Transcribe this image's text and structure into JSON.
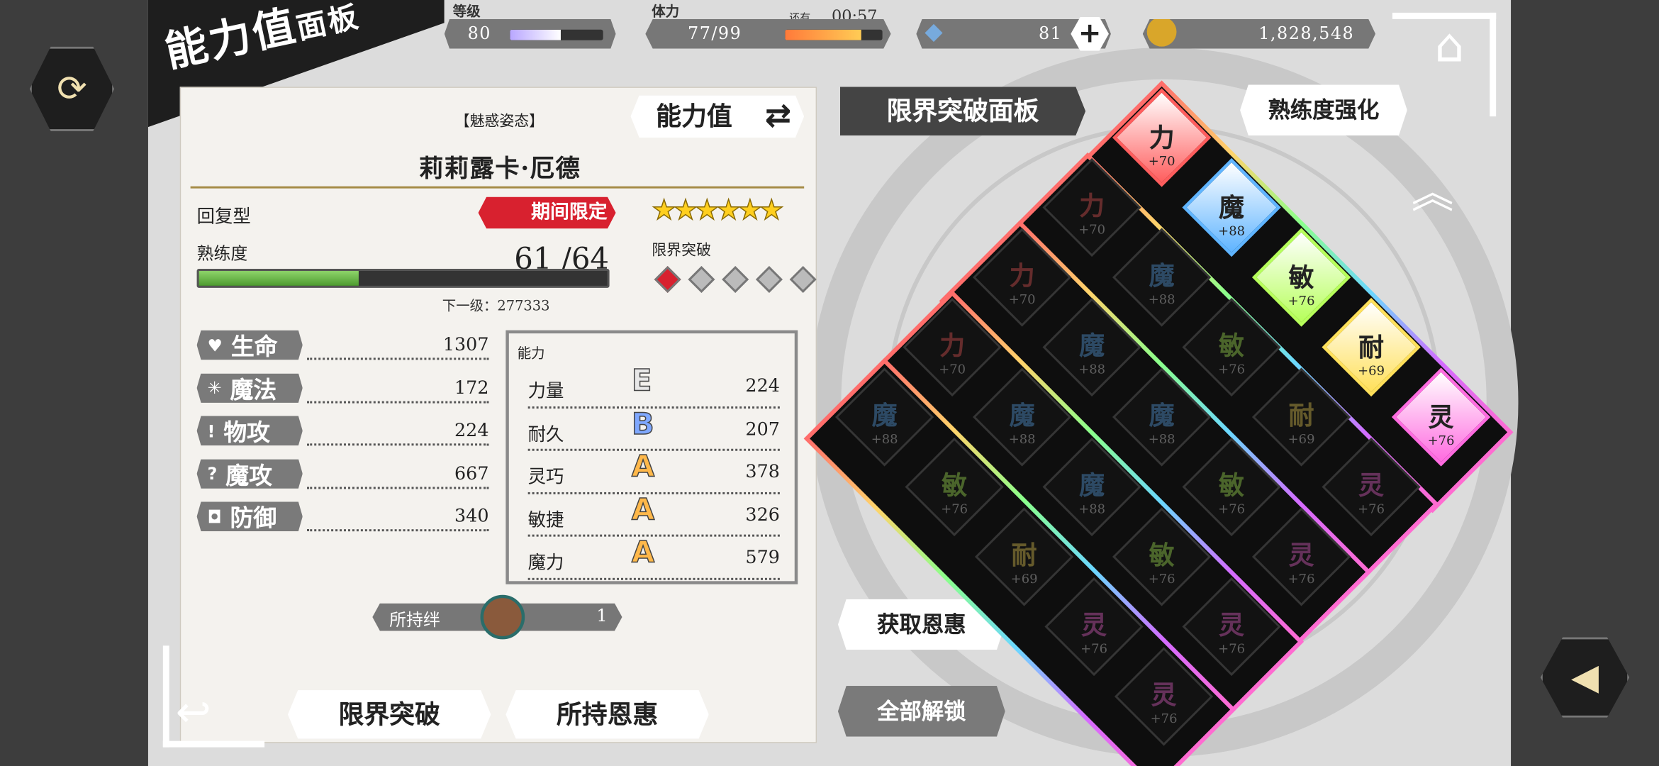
{
  "header": {
    "title_main": "能力值",
    "title_sub": "面板",
    "level_label": "等级",
    "level_value": "80",
    "level_fill": 0.55,
    "stamina_label": "体力",
    "stamina_value": "77/99",
    "recover_label": "还有",
    "recover_time": "00:57",
    "stamina_fill": 0.78,
    "gems": "81",
    "gold": "1,828,548"
  },
  "panel": {
    "costume": "【魅惑姿态】",
    "toggle_label": "能力值",
    "char_name": "莉莉露卡·厄德",
    "type": "回复型",
    "limited_badge": "期间限定",
    "stars": "★★★★★★",
    "proficiency_label": "熟练度",
    "proficiency_value": "61 /64",
    "proficiency_fill": 0.39,
    "next_level": "下一级：277333",
    "limit_break_label": "限界突破",
    "limit_break_count": 1,
    "limit_break_max": 5,
    "stats": [
      {
        "icon": "♥",
        "name": "生命",
        "value": "1307"
      },
      {
        "icon": "✳",
        "name": "魔法",
        "value": "172"
      },
      {
        "icon": "!",
        "name": "物攻",
        "value": "224"
      },
      {
        "icon": "?",
        "name": "魔攻",
        "value": "667"
      },
      {
        "icon": "◘",
        "name": "防御",
        "value": "340"
      }
    ],
    "abilities_label": "能力",
    "abilities": [
      {
        "name": "力量",
        "grade": "E",
        "value": "224",
        "color": "#e8e8e8"
      },
      {
        "name": "耐久",
        "grade": "B",
        "value": "207",
        "color": "#7fa8ff"
      },
      {
        "name": "灵巧",
        "grade": "A",
        "value": "378",
        "color": "#ffb84a"
      },
      {
        "name": "敏捷",
        "grade": "A",
        "value": "326",
        "color": "#ffb84a"
      },
      {
        "name": "魔力",
        "grade": "A",
        "value": "579",
        "color": "#ffb84a"
      }
    ],
    "bond_label": "所持绊",
    "bond_value": "1"
  },
  "right": {
    "panel_title": "限界突破面板",
    "mastery_button": "熟练度强化",
    "get_blessing": "获取恩惠",
    "unlock_all": "全部解锁"
  },
  "bottom": {
    "limit_break_btn": "限界突破",
    "owned_blessing_btn": "所持恩惠"
  },
  "grid": {
    "bright": [
      {
        "k": "力",
        "v": "+70"
      },
      {
        "k": "魔",
        "v": "+88"
      },
      {
        "k": "敏",
        "v": "+76"
      },
      {
        "k": "耐",
        "v": "+69"
      },
      {
        "k": "灵",
        "v": "+76"
      }
    ],
    "row2": [
      {
        "k": "力",
        "v": "+70"
      },
      {
        "k": "魔",
        "v": "+88"
      },
      {
        "k": "敏",
        "v": "+76"
      },
      {
        "k": "耐",
        "v": "+69"
      },
      {
        "k": "灵",
        "v": "+76"
      }
    ],
    "row3": [
      {
        "k": "力",
        "v": "+70"
      },
      {
        "k": "魔",
        "v": "+88"
      },
      {
        "k": "魔",
        "v": "+88"
      },
      {
        "k": "敏",
        "v": "+76"
      },
      {
        "k": "灵",
        "v": "+76"
      }
    ],
    "row4": [
      {
        "k": "力",
        "v": "+70"
      },
      {
        "k": "魔",
        "v": "+88"
      },
      {
        "k": "魔",
        "v": "+88"
      },
      {
        "k": "敏",
        "v": "+76"
      },
      {
        "k": "灵",
        "v": "+76"
      }
    ],
    "row5": [
      {
        "k": "魔",
        "v": "+88"
      },
      {
        "k": "敏",
        "v": "+76"
      },
      {
        "k": "耐",
        "v": "+69"
      },
      {
        "k": "灵",
        "v": "+76"
      },
      {
        "k": "灵",
        "v": "+76"
      }
    ],
    "colors": {
      "力": "#ff5d5d",
      "魔": "#5fb4ff",
      "敏": "#b6ff5a",
      "耐": "#ffe05a",
      "灵": "#ff6be0"
    }
  }
}
